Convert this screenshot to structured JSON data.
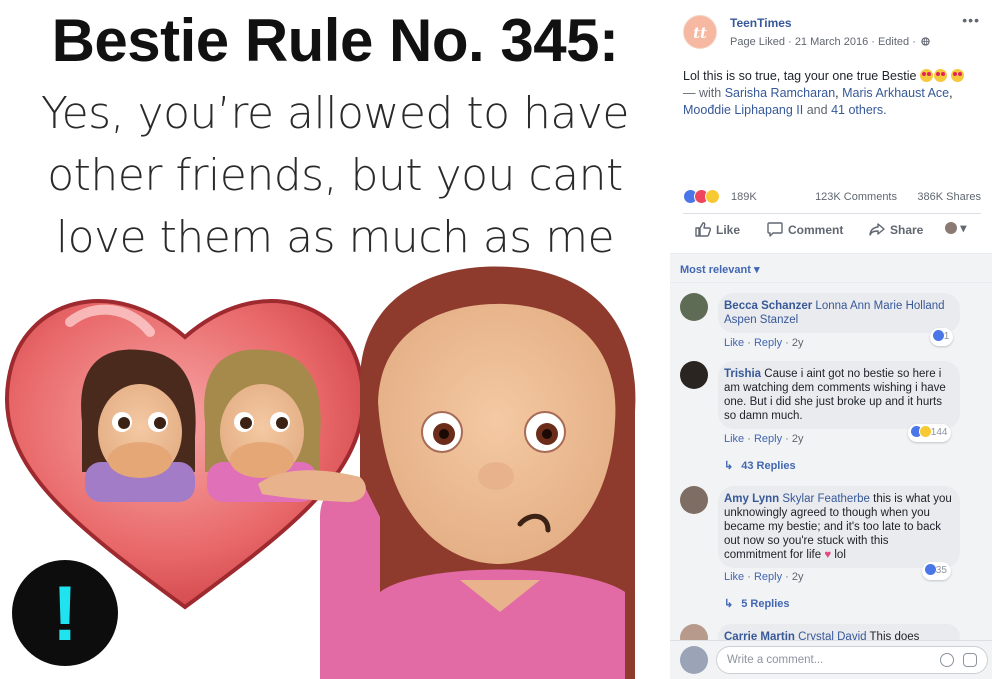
{
  "image": {
    "title": "Bestie Rule No. 345:",
    "lines": [
      "Yes, you’re allowed to have",
      "other friends, but you cant",
      "love them as much as me"
    ],
    "badge_glyph": "!"
  },
  "post": {
    "page_name": "TeenTimes",
    "avatar_text": "tt",
    "meta": "Page Liked · 21 March 2016 · Edited ·",
    "more": "•••",
    "caption": {
      "text": "Lol this is so true, tag your one true Bestie",
      "with": "— with",
      "tag1": "Sarisha Ramcharan",
      "comma1": ",",
      "tag2": "Maris Arkhaust Ace",
      "comma2": ",",
      "tag3": "Moođdie Liphapang II",
      "and": "and",
      "others": "41 others."
    },
    "reactions": {
      "count": "189K",
      "comments": "123K Comments",
      "shares": "386K Shares",
      "icons": [
        "like-icon",
        "love-icon",
        "haha-icon"
      ]
    },
    "actions": {
      "like": "Like",
      "comment": "Comment",
      "share": "Share",
      "audience_caret": "▾"
    },
    "sort_label": "Most relevant ▾",
    "comments": [
      {
        "author": "Becca Schanzer",
        "mention": "Lonna Ann Marie Holland Aspen Stanzel",
        "text": "",
        "actions": {
          "like": "Like",
          "reply": "Reply",
          "time": "2y"
        },
        "react_count": "1",
        "replies": ""
      },
      {
        "author": "Trishia",
        "mention": "",
        "text": "Cause i aint got no bestie so here i am watching dem comments wishing i have one. But i did she just broke up and it hurts so damn much.",
        "actions": {
          "like": "Like",
          "reply": "Reply",
          "time": "2y"
        },
        "react_count": "144",
        "replies": "43 Replies"
      },
      {
        "author": "Amy Lynn",
        "mention": "Skylar Featherbe",
        "text": "this is what you unknowingly agreed to though when you became my bestie; and it's too late to back out now so you're stuck with this commitment for life",
        "text_end": "lol",
        "actions": {
          "like": "Like",
          "reply": "Reply",
          "time": "2y"
        },
        "react_count": "35",
        "replies": "5 Replies"
      },
      {
        "author": "Carrie Martin",
        "mention": "Crystal David",
        "text": "This does"
      }
    ],
    "write_placeholder": "Write a comment..."
  },
  "colors": {
    "link": "#365899",
    "accent": "#4267b2",
    "like_blue": "#4a76e8",
    "love_red": "#f0455f",
    "haha_yellow": "#f7c933",
    "badge_cyan": "#20e3f0"
  }
}
